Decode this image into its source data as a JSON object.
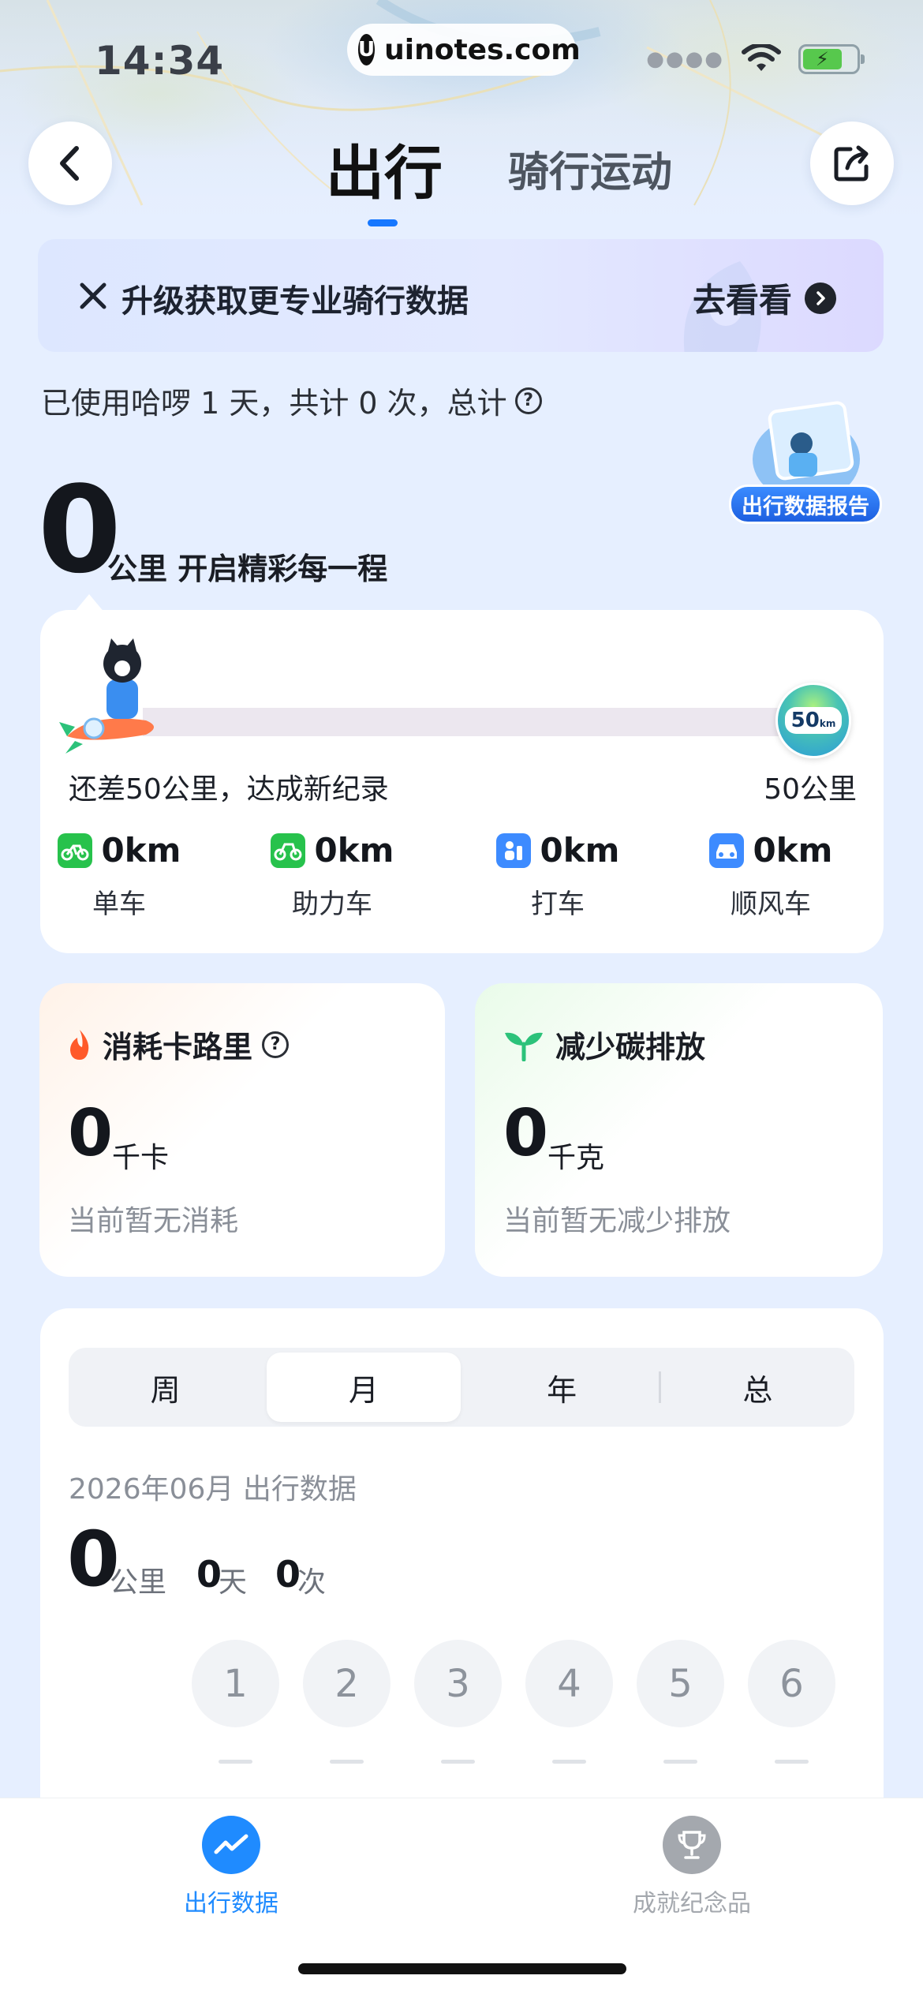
{
  "status_bar": {
    "time": "14:34",
    "url": "uinotes.com",
    "url_logo": "U"
  },
  "header": {
    "tab_active": "出行",
    "tab_other": "骑行运动",
    "back_icon": "chevron-left-icon",
    "share_icon": "share-icon"
  },
  "promo": {
    "text": "升级获取更专业骑行数据",
    "cta": "去看看"
  },
  "summary": {
    "usage_text": "已使用哈啰 1 天，共计 0 次，总计",
    "report_label": "出行数据报告",
    "total_km": "0",
    "total_label": "公里 开启精彩每一程"
  },
  "progress": {
    "left_text": "还差50公里，达成新纪录",
    "right_text": "50公里",
    "goal_badge": "50",
    "goal_badge_unit": "km",
    "fraction": 0
  },
  "modes": [
    {
      "value": "0km",
      "label": "单车",
      "icon": "bike-icon",
      "color": "#27c24c"
    },
    {
      "value": "0km",
      "label": "助力车",
      "icon": "ebike-icon",
      "color": "#27c24c"
    },
    {
      "value": "0km",
      "label": "打车",
      "icon": "taxi-icon",
      "color": "#3d8bff"
    },
    {
      "value": "0km",
      "label": "顺风车",
      "icon": "car-icon",
      "color": "#3d8bff"
    }
  ],
  "calories": {
    "title": "消耗卡路里",
    "value": "0",
    "unit": "千卡",
    "sub": "当前暂无消耗"
  },
  "carbon": {
    "title": "减少碳排放",
    "value": "0",
    "unit": "千克",
    "sub": "当前暂无减少排放"
  },
  "period": {
    "segments": [
      "周",
      "月",
      "年",
      "总"
    ],
    "active_segment": "月",
    "title": "2026年06月 出行数据",
    "km": "0",
    "km_unit": "公里",
    "days": "0",
    "days_unit": "天",
    "times": "0",
    "times_unit": "次",
    "day_numbers": [
      "1",
      "2",
      "3",
      "4",
      "5",
      "6"
    ]
  },
  "bottom_nav": {
    "items": [
      {
        "label": "出行数据",
        "icon": "trend-icon",
        "active": true,
        "color": "#1f8bff"
      },
      {
        "label": "成就纪念品",
        "icon": "trophy-icon",
        "active": false,
        "color": "#a4a8ae"
      }
    ]
  }
}
